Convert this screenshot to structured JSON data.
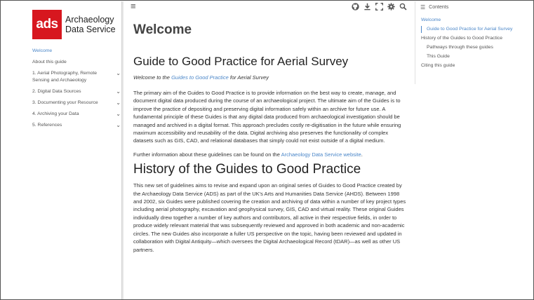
{
  "logo": {
    "mark": "ads",
    "line1": "Archaeology",
    "line2": "Data Service"
  },
  "nav": {
    "items": [
      {
        "label": "Welcome",
        "active": true,
        "chevron": false
      },
      {
        "label": "About this guide",
        "active": false,
        "chevron": false
      },
      {
        "label": "1. Aerial Photography, Remote Sensing and Archaeology",
        "active": false,
        "chevron": true
      },
      {
        "label": "2. Digital Data Sources",
        "active": false,
        "chevron": true
      },
      {
        "label": "3. Documenting your Resource",
        "active": false,
        "chevron": true
      },
      {
        "label": "4. Archiving your Data",
        "active": false,
        "chevron": true
      },
      {
        "label": "5. References",
        "active": false,
        "chevron": true
      }
    ]
  },
  "toolbar": {
    "icons": [
      "menu-icon",
      "github-icon",
      "download-icon",
      "fullscreen-icon",
      "settings-icon",
      "search-icon"
    ]
  },
  "main": {
    "title": "Welcome",
    "guide_heading": "Guide to Good Practice for Aerial Survey",
    "subtitle_prefix": "Welcome to the ",
    "subtitle_link": "Guides to Good Practice",
    "subtitle_suffix": " for Aerial Survey",
    "para1": "The primary aim of the Guides to Good Practice is to provide information on the best way to create, manage, and document digital data produced during the course of an archaeological project. The ultimate aim of the Guides is to improve the practice of depositing and preserving digital information safely within an archive for future use. A fundamental principle of these Guides is that any digital data produced from archaeological investigation should be managed and archived in a digital format. This approach precludes costly re-digitisation in the future while ensuring maximum accessibility and reusability of the data. Digital archiving also preserves the functionality of complex datasets such as GIS, CAD, and relational databases that simply could not exist outside of a digital medium.",
    "para2_prefix": "Further information about these guidelines can be found on the ",
    "para2_link": "Archaeology Data Service website",
    "para2_suffix": ".",
    "history_heading": "History of the Guides to Good Practice",
    "para3": "This new set of guidelines aims to revise and expand upon an original series of Guides to Good Practice created by the Archaeology Data Service (ADS) as part of the UK's Arts and Humanities Data Service (AHDS). Between 1998 and 2002, six Guides were published covering the creation and archiving of data within a number of key project types including aerial photography, excavation and geophysical survey, GIS, CAD and virtual reality. These original Guides individually drew together a number of key authors and contributors, all active in their respective fields, in order to produce widely relevant material that was subsequently reviewed and approved in both academic and non-academic circles. The new Guides also incorporate a fuller US perspective on the topic, having been reviewed and updated in collaboration with Digital Antiquity—which oversees the Digital Archaeological Record (tDAR)—as well as other US partners."
  },
  "toc": {
    "header": "Contents",
    "items": [
      {
        "label": "Welcome",
        "level": 1,
        "active": true
      },
      {
        "label": "Guide to Good Practice for Aerial Survey",
        "level": 2,
        "active": true
      },
      {
        "label": "History of the Guides to Good Practice",
        "level": 1,
        "active": false
      },
      {
        "label": "Pathways through these guides",
        "level": 2,
        "active": false
      },
      {
        "label": "This Guide",
        "level": 2,
        "active": false
      },
      {
        "label": "Citing this guide",
        "level": 1,
        "active": false
      }
    ]
  },
  "colors": {
    "accent": "#4a86c8",
    "brand": "#d7171f"
  }
}
